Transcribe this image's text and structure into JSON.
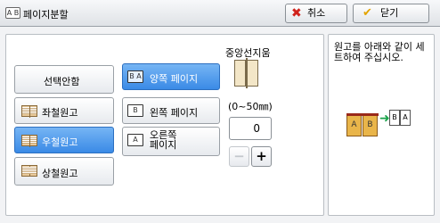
{
  "header": {
    "icon_text": "A B",
    "title": "페이지분할",
    "cancel_label": "취소",
    "close_label": "닫기"
  },
  "options_left": [
    {
      "label": "선택안함",
      "icon": "none",
      "selected": false
    },
    {
      "label": "좌철원고",
      "icon": "book-left-icon",
      "selected": false
    },
    {
      "label": "우철원고",
      "icon": "book-right-icon",
      "selected": true
    },
    {
      "label": "상철원고",
      "icon": "book-top-icon",
      "selected": false
    }
  ],
  "options_pages": [
    {
      "label": "양쪽 페이지",
      "icon_text": "B A",
      "selected": true
    },
    {
      "label": "왼쪽 페이지",
      "icon_text": "B",
      "selected": false
    },
    {
      "label_line1": "오른쪽",
      "label_line2": "페이지",
      "icon_text": "A",
      "selected": false
    }
  ],
  "center_erase": {
    "title": "중앙선지움",
    "range": "(0~50㎜)",
    "value": "0",
    "minus": "−",
    "plus": "+"
  },
  "info": {
    "text": "원고를 아래와 같이 세트하여 주십시오.",
    "page_a": "A",
    "page_b": "B",
    "out_b": "B",
    "out_a": "A"
  },
  "colors": {
    "selected_bg": "#3a8ae6",
    "cancel_x": "#d0221b",
    "check": "#e3a400"
  }
}
